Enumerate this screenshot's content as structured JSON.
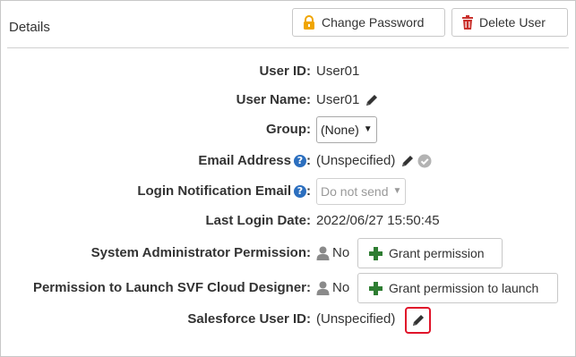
{
  "header": {
    "title": "Details",
    "change_password_label": "Change Password",
    "delete_user_label": "Delete User"
  },
  "fields": {
    "user_id": {
      "label": "User ID:",
      "value": "User01"
    },
    "user_name": {
      "label": "User Name:",
      "value": "User01"
    },
    "group": {
      "label": "Group:",
      "selected": "(None)"
    },
    "email": {
      "label": "Email Address",
      "colon": ":",
      "value": "(Unspecified)"
    },
    "login_notification": {
      "label": "Login Notification Email",
      "colon": ":",
      "selected": "Do not send"
    },
    "last_login": {
      "label": "Last Login Date:",
      "value": "2022/06/27 15:50:45"
    },
    "sys_admin": {
      "label": "System Administrator Permission:",
      "value": "No",
      "button_label": "Grant permission"
    },
    "svf_designer": {
      "label": "Permission to Launch SVF Cloud Designer:",
      "value": "No",
      "button_label": "Grant permission to launch"
    },
    "salesforce": {
      "label": "Salesforce User ID:",
      "value": "(Unspecified)"
    }
  },
  "help_icon_glyph": "?",
  "colors": {
    "lock_icon": "#f0a500",
    "trash_icon": "#c9302c",
    "plus_icon": "#2e7d32",
    "help_icon": "#2c6fbf",
    "highlight_border": "#e0142a"
  },
  "icons": [
    "lock-icon",
    "trash-icon",
    "pencil-icon",
    "check-circle-icon",
    "help-icon",
    "person-icon",
    "plus-icon",
    "chevron-down-icon"
  ]
}
